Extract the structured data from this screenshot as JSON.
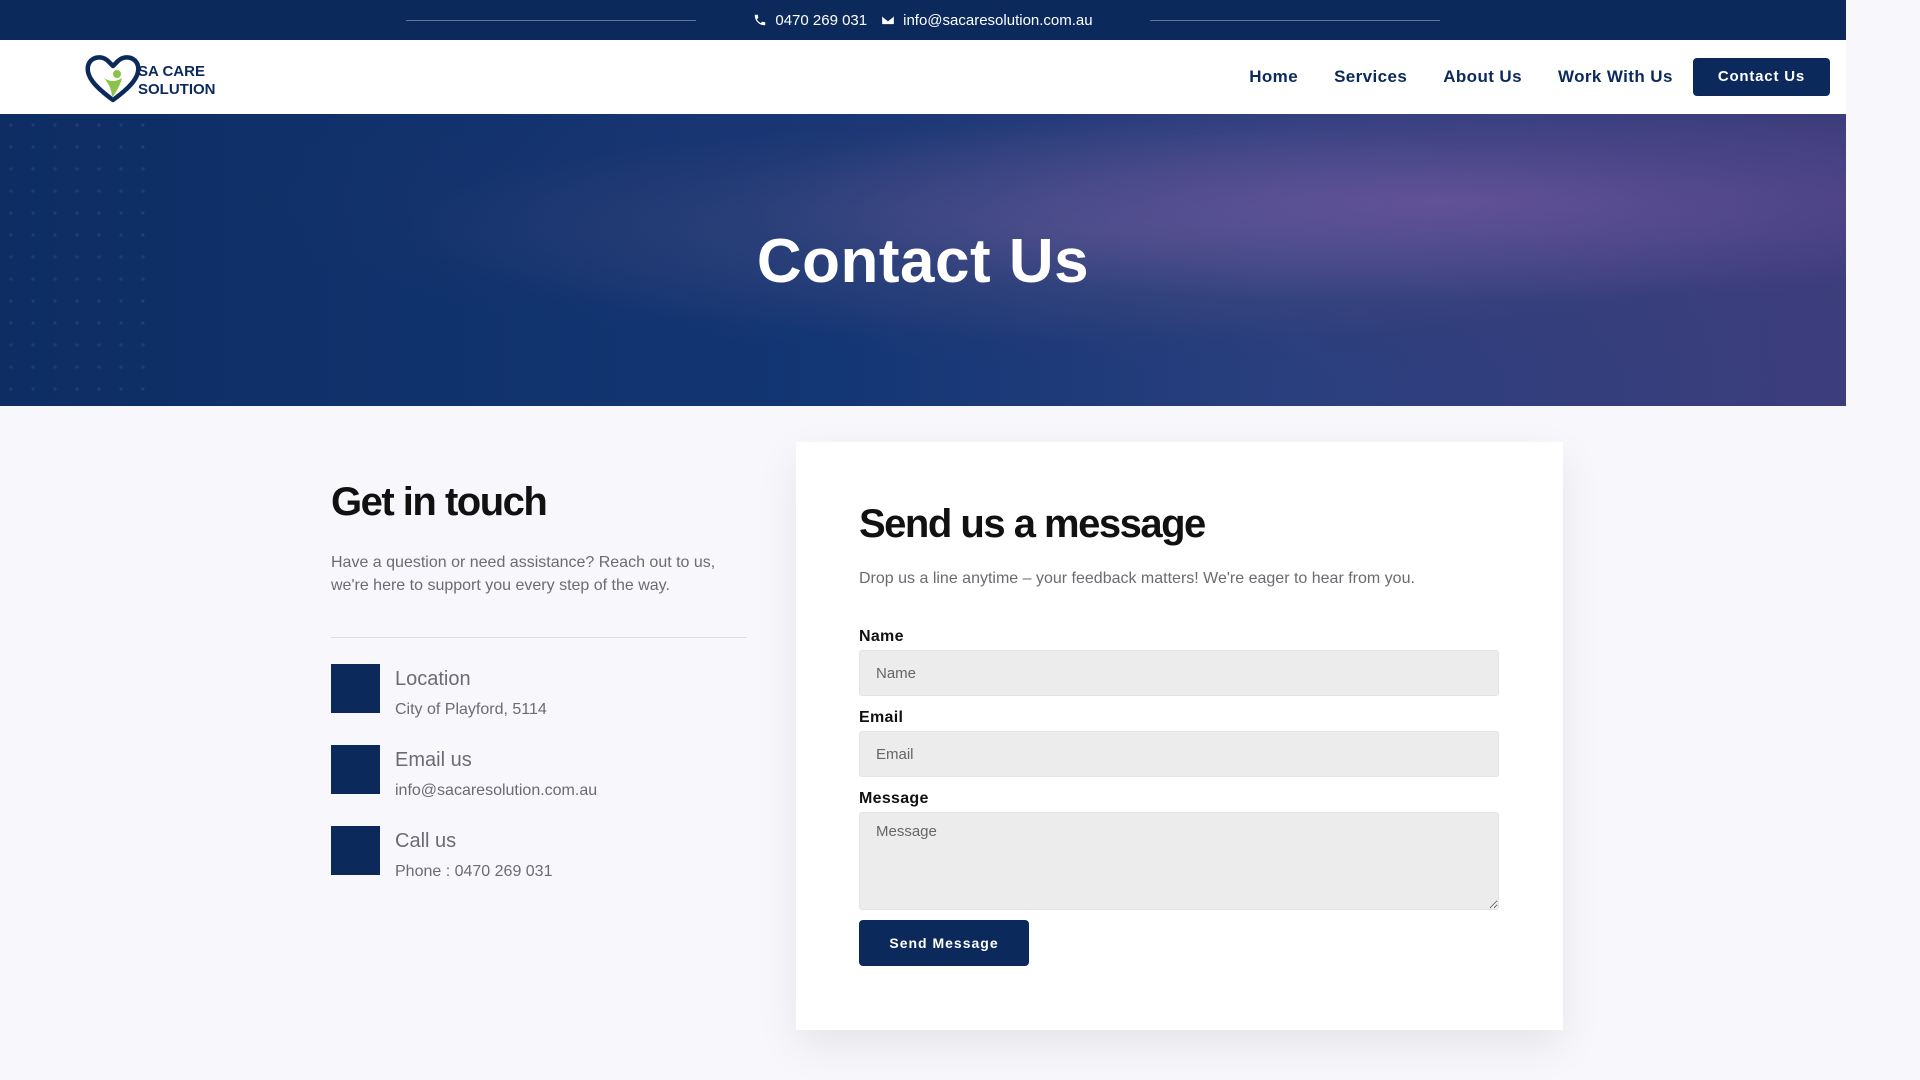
{
  "topbar": {
    "phone": "0470 269 031",
    "email": "info@sacaresolution.com.au",
    "phone_icon": "phone-icon",
    "email_icon": "envelope-icon"
  },
  "header": {
    "logo_line1": "SA CARE",
    "logo_line2": "SOLUTION",
    "nav": {
      "home": "Home",
      "services": "Services",
      "about": "About Us",
      "work": "Work With Us",
      "contact": "Contact Us"
    }
  },
  "hero": {
    "title": "Contact Us"
  },
  "getintouch": {
    "heading": "Get in touch",
    "intro": "Have a question or need assistance? Reach out to us, we're here to support you every step of the way.",
    "location_title": "Location",
    "location_value": "City of Playford, 5114",
    "email_title": "Email us",
    "email_value": "info@sacaresolution.com.au",
    "call_title": "Call us",
    "call_value": "Phone : 0470 269 031"
  },
  "form": {
    "heading": "Send us a message",
    "sub": "Drop us a line anytime – your feedback matters! We're eager to hear from you.",
    "name_label": "Name",
    "name_placeholder": "Name",
    "email_label": "Email",
    "email_placeholder": "Email",
    "message_label": "Message",
    "message_placeholder": "Message",
    "submit": "Send Message"
  },
  "colors": {
    "primary": "#0b2a5b",
    "logo_green": "#8bc34a"
  }
}
